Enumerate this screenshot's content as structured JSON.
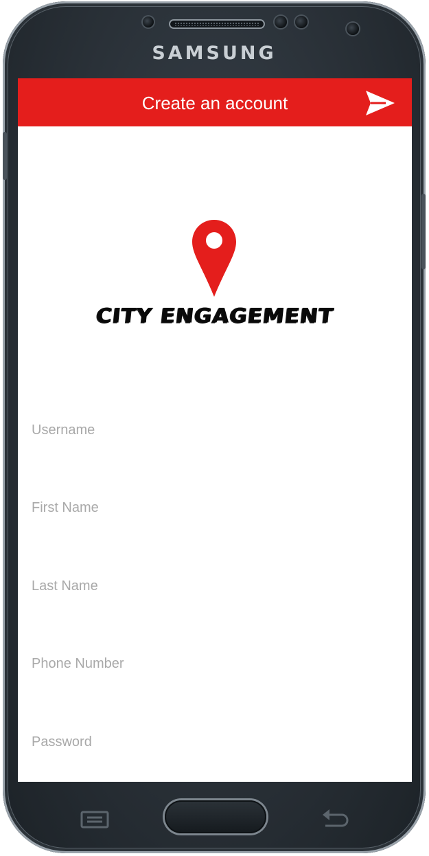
{
  "device": {
    "brand": "SAMSUNG"
  },
  "app_bar": {
    "title": "Create an account",
    "send_icon": "send-arrow-icon",
    "color": "#e41e1c"
  },
  "logo": {
    "icon": "map-pin-icon",
    "text": "CITY ENGAGEMENT"
  },
  "form": {
    "username": {
      "placeholder": "Username",
      "value": ""
    },
    "first_name": {
      "placeholder": "First Name",
      "value": ""
    },
    "last_name": {
      "placeholder": "Last Name",
      "value": ""
    },
    "phone_number": {
      "placeholder": "Phone Number",
      "value": ""
    },
    "password": {
      "placeholder": "Password",
      "value": ""
    }
  },
  "nav_keys": {
    "menu_icon": "menu-icon",
    "home": "home-button",
    "back_icon": "back-icon"
  }
}
